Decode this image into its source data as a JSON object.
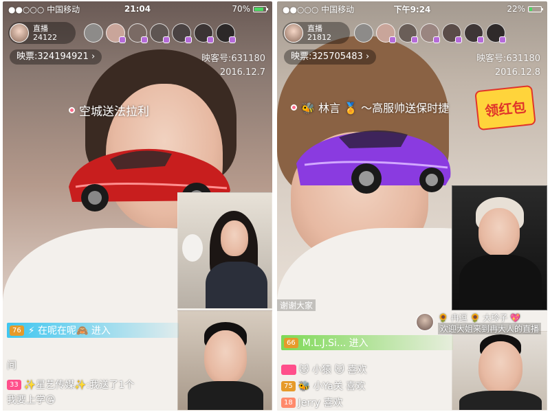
{
  "left": {
    "status": {
      "carrier": "●●○○○ 中国移动",
      "time": "21:04",
      "battery": "70%",
      "battery_level": 0.7
    },
    "host": {
      "label": "直播",
      "count": "24122"
    },
    "ticket": "映票:324194921 ›",
    "room_id": "映客号:631180",
    "date": "2016.12.7",
    "gift_caption": "空城送法拉利",
    "enter": {
      "level": "76",
      "text": "⚡ 在呢在呢🙈  进入"
    },
    "chat1": {
      "text": "间"
    },
    "chat2": {
      "level": "33",
      "text": "✨星艺传媒✨:我送了1个",
      "cont": "我要上学😘"
    }
  },
  "right": {
    "status": {
      "carrier": "●●○○○ 中国移动",
      "time": "下午9:24",
      "battery": "22%",
      "battery_level": 0.22
    },
    "host": {
      "label": "直播",
      "count": "21812"
    },
    "ticket": "映票:325705483 ›",
    "room_id": "映客号:631180",
    "date": "2016.12.8",
    "gift_caption": "🐝 林言 🏅 ～高服帅送保时捷",
    "sticker": "领红包",
    "thanks": "谢谢大家",
    "welcome_names": "🌻 冉逗 🌻 大玲子 💖",
    "welcome_text": "欢迎大姐来到冉大人的直播",
    "enter": {
      "level": "66",
      "text": "M.L.J.Si...  进入"
    },
    "chat1": {
      "level": "",
      "text": "🐱 小猿 🐱 喜欢"
    },
    "chat2": {
      "level": "75",
      "text": "🐝 小Ya关 喜欢"
    },
    "chat3": {
      "level": "18",
      "text": "Jerry 喜欢"
    }
  },
  "colors": {
    "accent_car_left": "#d42a2a",
    "accent_car_right": "#8a3be0",
    "enter_bar_left": "#3ec6f0",
    "enter_bar_right": "#7ed957"
  }
}
